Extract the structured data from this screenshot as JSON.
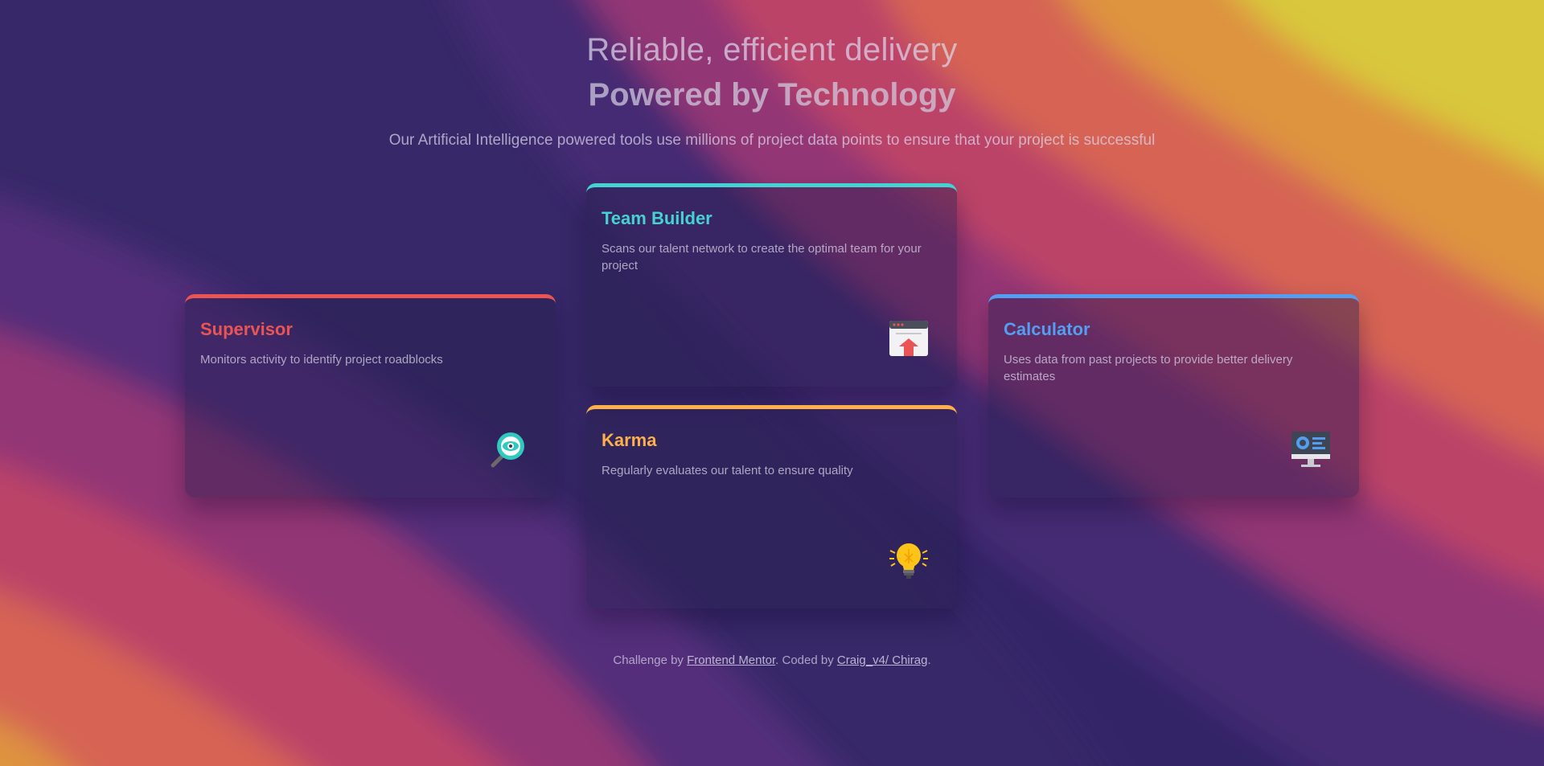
{
  "header": {
    "tagline": "Reliable, efficient delivery",
    "title": "Powered by Technology",
    "subtitle": "Our Artificial Intelligence powered tools use millions of project data points to ensure that your project is successful"
  },
  "cards": [
    {
      "title": "Supervisor",
      "description": "Monitors activity to identify project roadblocks",
      "icon": "magnifier-eye-icon",
      "accent": "#ea5454"
    },
    {
      "title": "Team Builder",
      "description": "Scans our talent network to create the optimal team for your project",
      "icon": "browser-upload-icon",
      "accent": "#44d3d2"
    },
    {
      "title": "Karma",
      "description": "Regularly evaluates our talent to ensure quality",
      "icon": "lightbulb-icon",
      "accent": "#fcaf4a"
    },
    {
      "title": "Calculator",
      "description": "Uses data from past projects to provide better delivery estimates",
      "icon": "monitor-dashboard-icon",
      "accent": "#549ef2"
    }
  ],
  "footer": {
    "prefix": "Challenge by ",
    "link1": "Frontend Mentor",
    "middle": ". Coded by ",
    "link2": "Craig_v4/ Chirag",
    "suffix": "."
  },
  "colors": {
    "red": "#ea5454",
    "cyan": "#44d3d2",
    "orange": "#fcaf4a",
    "blue": "#549ef2"
  }
}
